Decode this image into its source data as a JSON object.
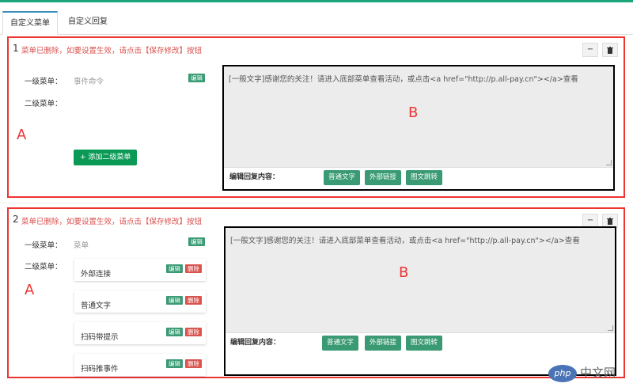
{
  "tabs": [
    "自定义菜单",
    "自定义回复"
  ],
  "groups": [
    {
      "number": "1",
      "note": "菜单已删除，如要设置生效，请点击【保存修改】按钮",
      "tool_minus": "−",
      "tool_delete_icon": "trash-icon",
      "level1_label": "一级菜单：",
      "level1_value": "事件命令",
      "edit_badge": "编辑",
      "level2_label": "二级菜单：",
      "add_sub_label": "+ 添加二级菜单",
      "annotation_left": "A",
      "annotation_right": "B",
      "reply_text": "[一般文字]感谢您的关注！请进入底部菜单查看活动，或点击<a href=\"http://p.all-pay.cn\"></a>查看",
      "reply_edit_label": "编辑回复内容：",
      "reply_buttons": [
        "普通文字",
        "外部链接",
        "图文跳转"
      ]
    },
    {
      "number": "2",
      "note": "菜单已删除，如要设置生效，请点击【保存修改】按钮",
      "tool_minus": "−",
      "tool_delete_icon": "trash-icon",
      "level1_label": "一级菜单：",
      "level1_value": "菜单",
      "edit_badge": "编辑",
      "level2_label": "二级菜单：",
      "sub_items": [
        {
          "label": "外部连接",
          "edit": "编辑",
          "delete": "删除"
        },
        {
          "label": "普通文字",
          "edit": "编辑",
          "delete": "删除"
        },
        {
          "label": "扫码带提示",
          "edit": "编辑",
          "delete": "删除"
        },
        {
          "label": "扫码推事件",
          "edit": "编辑",
          "delete": "删除"
        }
      ],
      "annotation_left": "A",
      "annotation_right": "B",
      "reply_text": "[一般文字]感谢您的关注！请进入底部菜单查看活动，或点击<a href=\"http://p.all-pay.cn\"></a>查看",
      "reply_edit_label": "编辑回复内容：",
      "reply_buttons": [
        "普通文字",
        "外部链接",
        "图文跳转"
      ]
    }
  ],
  "watermark": {
    "logo": "php",
    "text": "中文网"
  },
  "colors": {
    "accent": "#1aa57a",
    "annotation": "#ee3333",
    "edit": "#3a9a74",
    "delete": "#d9534f",
    "add": "#0a9a55"
  }
}
